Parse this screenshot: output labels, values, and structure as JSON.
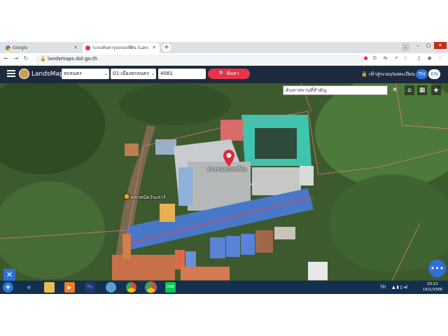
{
  "browser": {
    "tabs": [
      {
        "label": "Google",
        "active": false
      },
      {
        "label": "ระบบค้นหารูปแปลงที่ดิน (LandsMaps)",
        "active": true
      }
    ],
    "url": "landsmaps.dol.go.th"
  },
  "app": {
    "brand": "LandsMaps",
    "province": "สกลนคร",
    "district": "01-เมืองสกลนคร",
    "parcel_number": "4081",
    "search_label": "ค้นหา",
    "login_label": "เข้าสู่ระบบ/ลงทะเบียน",
    "lang_th": "TH",
    "lang_en": "EN"
  },
  "map": {
    "place_search_placeholder": "ค้นหาสถานที่สำคัญ",
    "marker_label": "ตำแหน่งแปลงที่ดิน",
    "poi_label": "ตลาดนัดวันเสาร์"
  },
  "taskbar": {
    "lang": "TH",
    "time": "20:21",
    "date": "16/1/2566"
  }
}
